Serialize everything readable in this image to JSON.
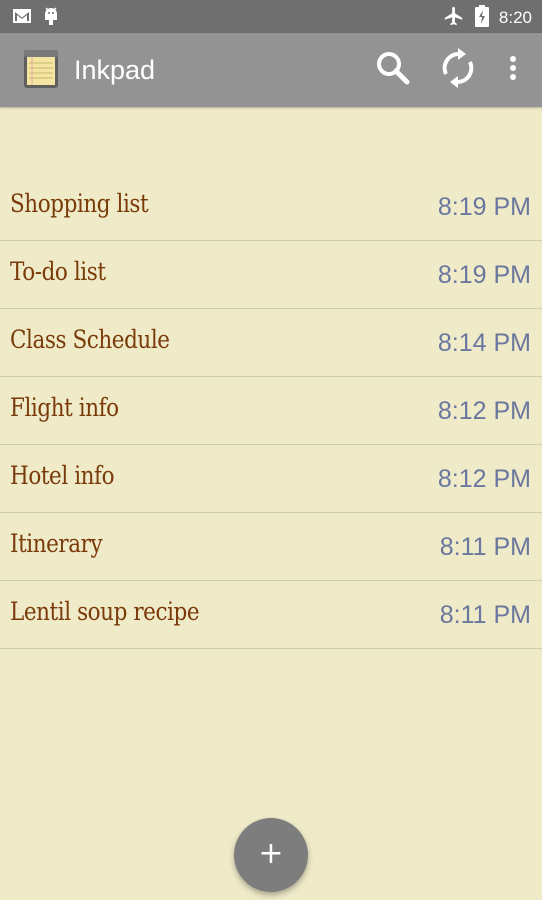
{
  "status_bar": {
    "time": "8:20",
    "icons": [
      "gmail-icon",
      "android-debug-icon",
      "airplane-mode-icon",
      "battery-charging-icon"
    ]
  },
  "app_bar": {
    "title": "Inkpad",
    "logo": "notepad-logo",
    "actions": [
      "search-icon",
      "sync-icon",
      "overflow-menu-icon"
    ]
  },
  "notes": [
    {
      "title": "Shopping list",
      "time": "8:19 PM"
    },
    {
      "title": "To-do list",
      "time": "8:19 PM"
    },
    {
      "title": "Class Schedule",
      "time": "8:14 PM"
    },
    {
      "title": "Flight info",
      "time": "8:12 PM"
    },
    {
      "title": "Hotel info",
      "time": "8:12 PM"
    },
    {
      "title": "Itinerary",
      "time": "8:11 PM"
    },
    {
      "title": "Lentil soup recipe",
      "time": "8:11 PM"
    }
  ],
  "fab": {
    "label": "+"
  },
  "colors": {
    "background": "#efeac8",
    "status_bar": "#6f6f6f",
    "app_bar": "#939393",
    "note_title": "#7a3a0a",
    "note_time": "#6a779e",
    "fab": "#7d7d7d"
  }
}
